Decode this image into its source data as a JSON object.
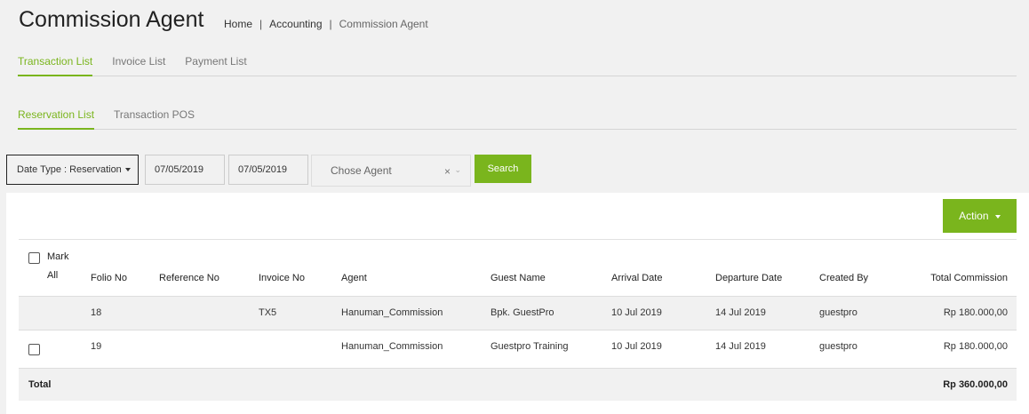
{
  "page": {
    "title": "Commission Agent"
  },
  "breadcrumb": {
    "home": "Home",
    "sep": "|",
    "accounting": "Accounting",
    "current": "Commission Agent"
  },
  "main_tabs": [
    {
      "label": "Transaction List",
      "active": true
    },
    {
      "label": "Invoice List",
      "active": false
    },
    {
      "label": "Payment List",
      "active": false
    }
  ],
  "sub_tabs": [
    {
      "label": "Reservation List",
      "active": true
    },
    {
      "label": "Transaction POS",
      "active": false
    }
  ],
  "filters": {
    "date_type_label": "Date Type : Reservation",
    "date_from": "07/05/2019",
    "date_to": "07/05/2019",
    "agent_placeholder": "Chose Agent",
    "agent_clear": "×",
    "agent_chevron": "⌄",
    "search_label": "Search"
  },
  "action": {
    "label": "Action"
  },
  "table": {
    "mark_all_line1": "Mark",
    "mark_all_line2": "All",
    "columns": {
      "folio": "Folio No",
      "reference": "Reference No",
      "invoice": "Invoice No",
      "agent": "Agent",
      "guest": "Guest Name",
      "arrival": "Arrival Date",
      "departure": "Departure Date",
      "created": "Created By",
      "commission": "Total Commission"
    },
    "rows": [
      {
        "folio": "18",
        "reference": "",
        "invoice": "TX5",
        "agent": "Hanuman_Commission",
        "guest": "Bpk. GuestPro",
        "arrival": "10 Jul 2019",
        "departure": "14 Jul 2019",
        "created": "guestpro",
        "commission": "Rp 180.000,00"
      },
      {
        "folio": "19",
        "reference": "",
        "invoice": "",
        "agent": "Hanuman_Commission",
        "guest": "Guestpro Training",
        "arrival": "10 Jul 2019",
        "departure": "14 Jul 2019",
        "created": "guestpro",
        "commission": "Rp 180.000,00"
      }
    ],
    "total_label": "Total",
    "total_value": "Rp 360.000,00"
  }
}
